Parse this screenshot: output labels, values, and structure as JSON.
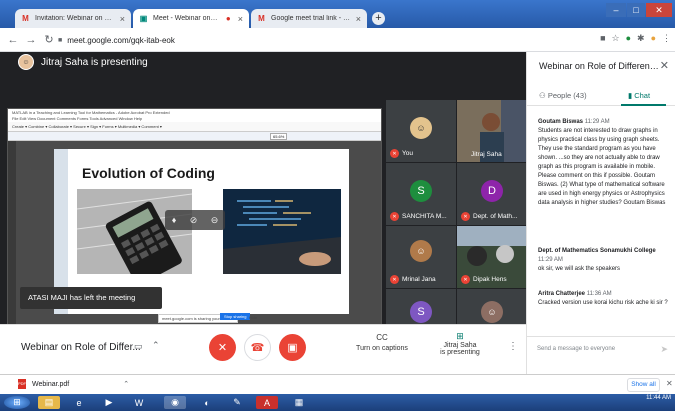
{
  "browser": {
    "tabs": [
      {
        "title": "Invitation: Webinar on Role of D",
        "icon": "gmail-icon"
      },
      {
        "title": "Meet - Webinar on Role of D",
        "icon": "meet-icon"
      },
      {
        "title": "Google meet trial link - subhenc",
        "icon": "gmail-icon"
      }
    ],
    "url": "meet.google.com/gqk-itab-eok"
  },
  "meet": {
    "presenter_banner": "Jitraj Saha is presenting",
    "shared_window": {
      "title_line": "MATLAB in a Teaching and Learning Tool for Mathematics - Adobe Acrobat Pro Extended",
      "menu_line": "File  Edit  View  Document  Comments  Forms  Tools  Advanced  Window  Help",
      "toolbar_line": "Create ▾   Combine ▾   Collaborate ▾   Secure ▾   Sign ▾   Forms ▾   Multimedia ▾   Comment ▾",
      "zoom": "65.6%",
      "slide_title": "Evolution of Coding",
      "share_caption": "meet.google.com is sharing your screen.",
      "stop_label": "Stop sharing",
      "hide_label": "Hide"
    },
    "toast": "ATASI MAJI has left the meeting",
    "tiles": [
      {
        "name": "You"
      },
      {
        "name": "Jitraj Saha"
      },
      {
        "name": "SANCHITA M...",
        "initial": "S",
        "color": "#1e8e3e"
      },
      {
        "name": "Dept. of Math...",
        "initial": "D",
        "color": "#8e24aa"
      },
      {
        "name": "Mrinal Jana"
      },
      {
        "name": "Dipak Hens"
      },
      {
        "name": "",
        "initial": "S",
        "color": "#7e57c2"
      }
    ],
    "bottom": {
      "meeting_title": "Webinar on Role of Differ...",
      "captions_label": "Turn on captions",
      "presenting_name": "Jitraj Saha",
      "presenting_label": "is presenting"
    }
  },
  "panel": {
    "title": "Webinar on Role of Different...",
    "people_label": "People (43)",
    "chat_label": "Chat",
    "messages": [
      {
        "sender": "Goutam Biswas",
        "time": "11:29 AM",
        "text": "Students are not interested to draw graphs in physics practical class by using graph sheets. They use the standard program as you have shown. ...so they are not actually able to draw graph as this program is available in mobile. Please comment on this if possible. Goutam Biswas.   (2) What type of mathematical software are used in high energy physics or Astrophysics data analysis in higher studies? Goutam Biswas"
      },
      {
        "sender": "Dept. of Mathematics Sonamukhi College",
        "time": "11:29 AM",
        "text": "ok sir, we will ask the speakers"
      },
      {
        "sender": "Aritra Chatterjee",
        "time": "11:36 AM",
        "text": "Cracked version use korai kichu risk ache ki sir ?"
      }
    ],
    "send_placeholder": "Send a message to everyone"
  },
  "downloads": {
    "file": "Webinar.pdf",
    "show_all": "Show all"
  },
  "taskbar": {
    "time": "11:44 AM"
  }
}
